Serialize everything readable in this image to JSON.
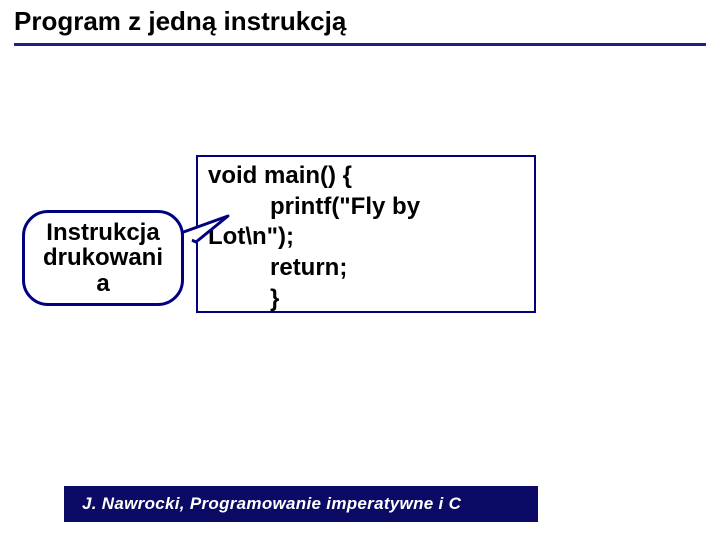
{
  "title": "Program z jedną instrukcją",
  "code": {
    "line1": "void main() {",
    "line2": "printf(\"Fly by",
    "line3": "Lot\\n\");",
    "line4": "return;",
    "line5": "}"
  },
  "callout_line1": "Instrukcja",
  "callout_line2": "drukowani",
  "callout_line3": "a",
  "footer": "J. Nawrocki, Programowanie imperatywne i C"
}
